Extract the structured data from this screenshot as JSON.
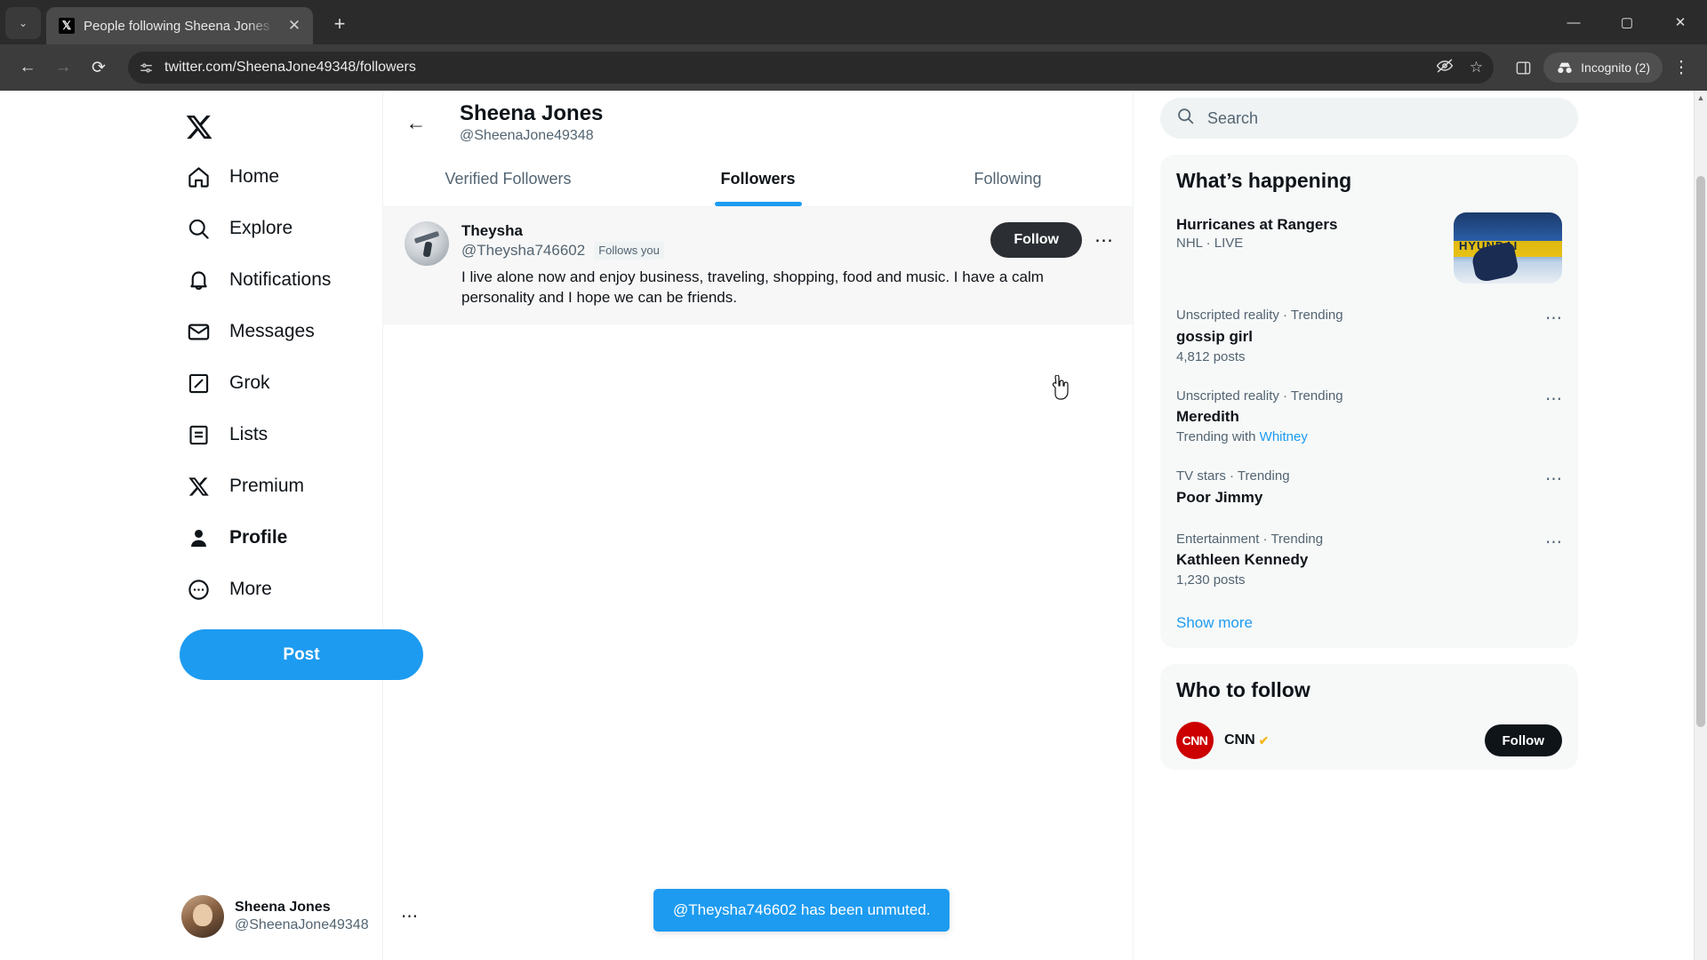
{
  "browser": {
    "tab": {
      "title": "People following Sheena Jones",
      "favicon": "𝕏",
      "close_icon": "✕"
    },
    "tab_list_icon": "⌄",
    "new_tab_icon": "+",
    "window": {
      "minimize": "—",
      "maximize": "▢",
      "close": "✕"
    },
    "nav": {
      "back": "←",
      "forward": "→",
      "reload": "⟳"
    },
    "omnibox": {
      "site_info_icon": "site-settings-icon",
      "url": "twitter.com/SheenaJone49348/followers",
      "tracking_icon": "👁",
      "bookmark_icon": "☆"
    },
    "split_view_icon": "▯",
    "incognito": {
      "label": "Incognito (2)",
      "icon": "incognito-hat"
    },
    "menu_icon": "⋮"
  },
  "sidebar": {
    "logo": "𝕏",
    "items": [
      {
        "label": "Home",
        "icon": "home-icon",
        "active": false
      },
      {
        "label": "Explore",
        "icon": "search-icon",
        "active": false
      },
      {
        "label": "Notifications",
        "icon": "bell-icon",
        "active": false
      },
      {
        "label": "Messages",
        "icon": "envelope-icon",
        "active": false
      },
      {
        "label": "Grok",
        "icon": "grok-icon",
        "active": false
      },
      {
        "label": "Lists",
        "icon": "lists-icon",
        "active": false
      },
      {
        "label": "Premium",
        "icon": "x-icon",
        "active": false
      },
      {
        "label": "Profile",
        "icon": "person-icon",
        "active": true
      },
      {
        "label": "More",
        "icon": "more-circle-icon",
        "active": false
      }
    ],
    "post_button": "Post",
    "account": {
      "name": "Sheena Jones",
      "handle": "@SheenaJone49348",
      "menu_icon": "⋯"
    }
  },
  "main": {
    "back_icon": "←",
    "title": "Sheena Jones",
    "subtitle": "@SheenaJone49348",
    "tabs": [
      {
        "label": "Verified Followers",
        "active": false
      },
      {
        "label": "Followers",
        "active": true
      },
      {
        "label": "Following",
        "active": false
      }
    ],
    "followers": [
      {
        "name": "Theysha",
        "handle": "@Theysha746602",
        "badge": "Follows you",
        "bio": "I live alone now and enjoy business, traveling, shopping, food and music. I have a calm personality and I hope we can be friends.",
        "follow_button": "Follow",
        "more_icon": "⋯"
      }
    ]
  },
  "toast": {
    "message": "@Theysha746602 has been unmuted.",
    "color": "#1d9bf0"
  },
  "right": {
    "search": {
      "placeholder": "Search",
      "icon": "search-icon"
    },
    "whats_happening": {
      "title": "What’s happening",
      "featured": {
        "title": "Hurricanes at Rangers",
        "meta": "NHL · LIVE",
        "thumb_text": "HYUNDAI"
      },
      "trends": [
        {
          "meta": "Unscripted reality · Trending",
          "name": "gossip girl",
          "posts": "4,812 posts",
          "with": null,
          "with_link": null,
          "more_icon": "⋯"
        },
        {
          "meta": "Unscripted reality · Trending",
          "name": "Meredith",
          "posts": null,
          "with": "Trending with",
          "with_link": "Whitney",
          "more_icon": "⋯"
        },
        {
          "meta": "TV stars · Trending",
          "name": "Poor Jimmy",
          "posts": null,
          "with": null,
          "with_link": null,
          "more_icon": "⋯"
        },
        {
          "meta": "Entertainment · Trending",
          "name": "Kathleen Kennedy",
          "posts": "1,230 posts",
          "with": null,
          "with_link": null,
          "more_icon": "⋯"
        }
      ],
      "show_more": "Show more"
    },
    "who_to_follow": {
      "title": "Who to follow",
      "accounts": [
        {
          "name": "CNN",
          "avatar_text": "CNN",
          "verified": "✔",
          "follow_button": "Follow"
        }
      ]
    }
  },
  "colors": {
    "accent": "#1d9bf0",
    "text": "#0f1419",
    "muted": "#536471",
    "dark_btn": "#0f1419"
  }
}
